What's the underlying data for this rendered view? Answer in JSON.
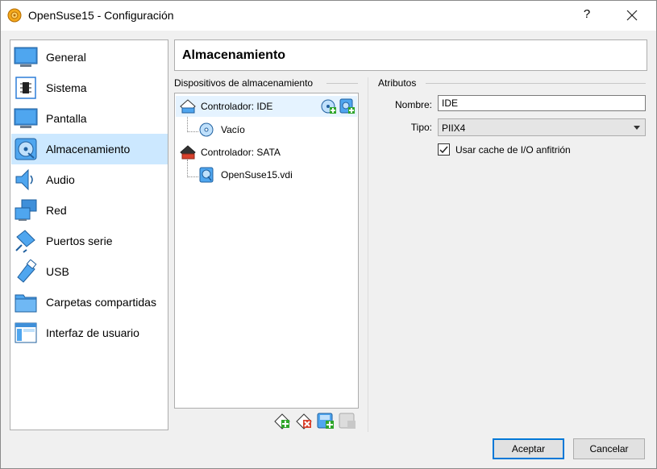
{
  "window": {
    "title": "OpenSuse15 - Configuración",
    "help_label": "?"
  },
  "sidebar": {
    "items": [
      {
        "label": "General",
        "icon": "monitor-icon"
      },
      {
        "label": "Sistema",
        "icon": "chip-icon"
      },
      {
        "label": "Pantalla",
        "icon": "display-icon"
      },
      {
        "label": "Almacenamiento",
        "icon": "storage-disc-icon",
        "selected": true
      },
      {
        "label": "Audio",
        "icon": "speaker-icon"
      },
      {
        "label": "Red",
        "icon": "network-icon"
      },
      {
        "label": "Puertos serie",
        "icon": "serial-port-icon"
      },
      {
        "label": "USB",
        "icon": "usb-icon"
      },
      {
        "label": "Carpetas compartidas",
        "icon": "folder-icon"
      },
      {
        "label": "Interfaz de usuario",
        "icon": "user-interface-icon"
      }
    ]
  },
  "page": {
    "title": "Almacenamiento"
  },
  "devices": {
    "group_label": "Dispositivos de almacenamiento",
    "tree": [
      {
        "label": "Controlador: IDE",
        "kind": "controller"
      },
      {
        "label": "Vacío",
        "kind": "optical"
      },
      {
        "label": "Controlador: SATA",
        "kind": "controller"
      },
      {
        "label": "OpenSuse15.vdi",
        "kind": "hard-disk"
      }
    ]
  },
  "attributes": {
    "group_label": "Atributos",
    "name_label": "Nombre:",
    "name_value": "IDE",
    "type_label": "Tipo:",
    "type_value": "PIIX4",
    "cache_label": "Usar cache de I/O anfitrión",
    "cache_checked": true
  },
  "buttons": {
    "accept": "Aceptar",
    "cancel": "Cancelar"
  },
  "colors": {
    "selection": "#cce8ff",
    "accent": "#0078d7",
    "add_green": "#2fa52a",
    "remove_red": "#d9412d"
  }
}
